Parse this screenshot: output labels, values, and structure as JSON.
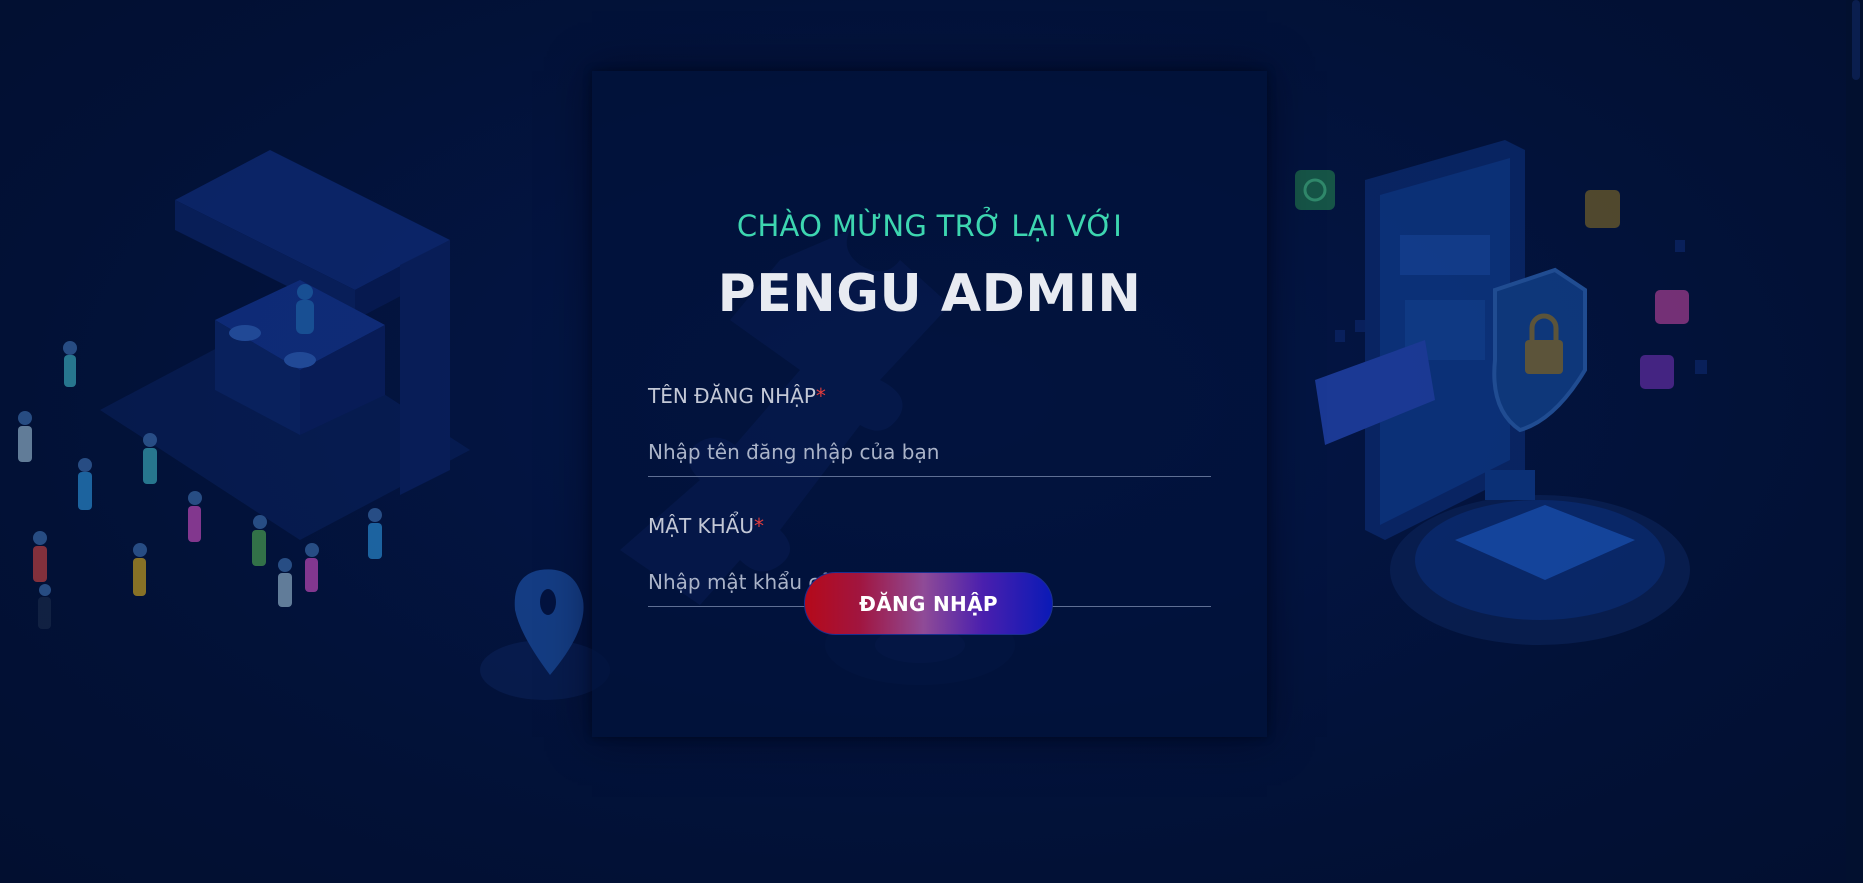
{
  "login": {
    "welcome_text": "CHÀO MỪNG TRỞ LẠI VỚI",
    "brand_title": "PENGU ADMIN",
    "username": {
      "label": "TÊN ĐĂNG NHẬP",
      "required_mark": "*",
      "placeholder": "Nhập tên đăng nhập của bạn",
      "value": ""
    },
    "password": {
      "label": "MẬT KHẨU",
      "required_mark": "*",
      "placeholder": "Nhập mật khẩu của bạn",
      "value": ""
    },
    "submit_label": "ĐĂNG NHẬP"
  },
  "colors": {
    "background": "#021136",
    "accent_teal": "#3dd6b0",
    "required_red": "#e23c3c",
    "button_gradient_start": "#b5091a",
    "button_gradient_end": "#0a1ab6"
  },
  "icons": {
    "background_left": "party-dj-illustration",
    "background_center": "puzzle-piece-location-illustration",
    "background_right": "phone-security-stadium-illustration"
  }
}
